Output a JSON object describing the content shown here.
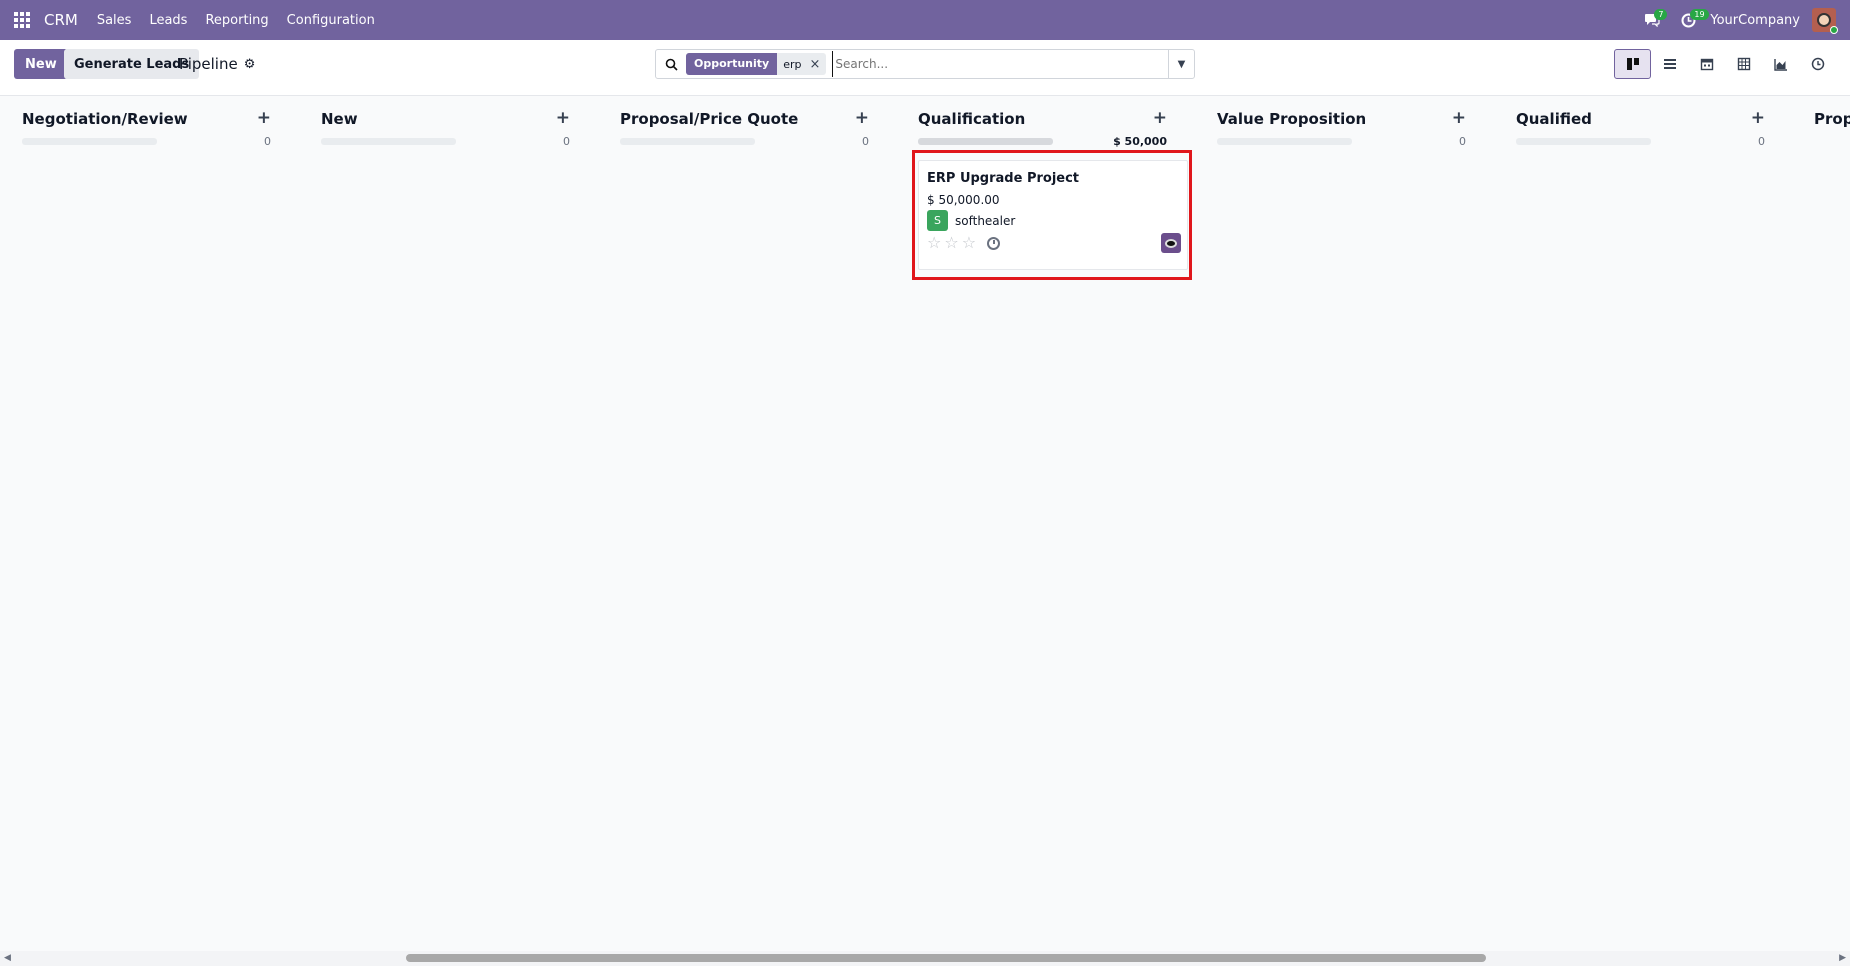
{
  "navbar": {
    "brand": "CRM",
    "menu": [
      "Sales",
      "Leads",
      "Reporting",
      "Configuration"
    ],
    "messages_badge": "7",
    "activities_badge": "19",
    "company": "YourCompany"
  },
  "control": {
    "new_label": "New",
    "generate_label": "Generate Leads",
    "breadcrumb": "Pipeline",
    "facet_label": "Opportunity",
    "facet_value": "erp",
    "facet_remove": "×",
    "search_placeholder": "Search...",
    "view_icons": [
      "kanban-icon",
      "list-icon",
      "calendar-icon",
      "pivot-icon",
      "graph-icon",
      "activity-icon"
    ]
  },
  "columns": [
    {
      "title": "Negotiation/Review",
      "total": "0"
    },
    {
      "title": "New",
      "total": "0"
    },
    {
      "title": "Proposal/Price Quote",
      "total": "0"
    },
    {
      "title": "Qualification",
      "total": "$ 50,000"
    },
    {
      "title": "Value Proposition",
      "total": "0"
    },
    {
      "title": "Qualified",
      "total": "0"
    },
    {
      "title": "Proposition",
      "total": ""
    }
  ],
  "card": {
    "title": "ERP Upgrade Project",
    "amount": "$ 50,000.00",
    "partner_initial": "S",
    "partner": "softhealer",
    "rating": 0,
    "rating_max": 3
  },
  "colors": {
    "brand": "#71639e",
    "highlight": "#e0161b",
    "partner_avatar": "#3aa55d"
  }
}
